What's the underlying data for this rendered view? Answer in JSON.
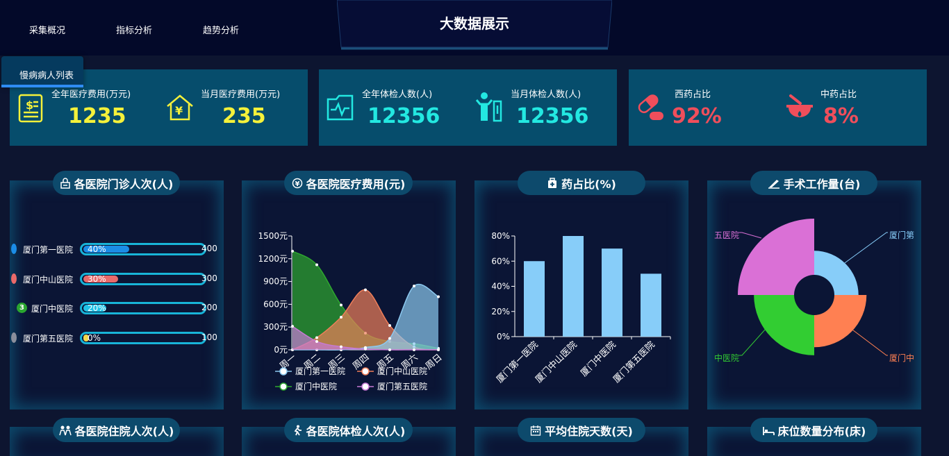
{
  "header": {
    "title": "大数据展示",
    "nav": [
      "采集概况",
      "指标分析",
      "趋势分析"
    ],
    "tab_label": "慢病病人列表"
  },
  "stats": [
    {
      "items": [
        {
          "label": "全年医疗费用(万元)",
          "value": "1235",
          "icon": "bill-icon"
        },
        {
          "label": "当月医疗费用(万元)",
          "value": "235",
          "icon": "house-yen-icon"
        }
      ],
      "color": "#f5f13a"
    },
    {
      "items": [
        {
          "label": "全年体检人数(人)",
          "value": "12356",
          "icon": "medical-folder-icon"
        },
        {
          "label": "当月体检人数(人)",
          "value": "12356",
          "icon": "person-check-icon"
        }
      ],
      "color": "#23e8e1"
    },
    {
      "items": [
        {
          "label": "西药占比",
          "value": "92%",
          "icon": "pill-icon"
        },
        {
          "label": "中药占比",
          "value": "8%",
          "icon": "mortar-icon"
        }
      ],
      "color": "#f04e5b"
    }
  ],
  "panels": {
    "outpatient": {
      "title": "各医院门诊人次(人)",
      "icon": "lock-icon"
    },
    "cost": {
      "title": "各医院医疗费用(元)",
      "icon": "yen-circle-icon"
    },
    "drug": {
      "title": "药占比(%)",
      "icon": "medkit-icon"
    },
    "surgery": {
      "title": "手术工作量(台)",
      "icon": "scalpel-icon"
    },
    "inpatient": {
      "title": "各医院住院人次(人)",
      "icon": "people-icon"
    },
    "checkup": {
      "title": "各医院体检人次(人)",
      "icon": "walk-icon"
    },
    "avgdays": {
      "title": "平均住院天数(天)",
      "icon": "calendar-icon"
    },
    "beds": {
      "title": "床位数量分布(床)",
      "icon": "bed-icon"
    }
  },
  "outpatient_rows": [
    {
      "rank": "1",
      "name": "厦门第一医院",
      "pct": "40%",
      "value": "400",
      "fraction": 0.4,
      "color": "#1b8de6",
      "rankColor": "#1b8de6"
    },
    {
      "rank": "2",
      "name": "厦门中山医院",
      "pct": "30%",
      "value": "300",
      "fraction": 0.3,
      "color": "#e86a6a",
      "rankColor": "#e86a6a"
    },
    {
      "rank": "3",
      "name": "厦门中医院",
      "pct": "20%",
      "value": "200",
      "fraction": 0.2,
      "color": "#21c3e6",
      "rankColor": "#2aa630"
    },
    {
      "rank": "4",
      "name": "厦门第五医院",
      "pct": "0%",
      "value": "100",
      "fraction": 0.05,
      "color": "#f2d64b",
      "rankColor": "#8a8f9c"
    }
  ],
  "chart_data": [
    {
      "type": "area",
      "x": [
        "周一",
        "周二",
        "周三",
        "周四",
        "周五",
        "周六",
        "周日"
      ],
      "ylabels": [
        "0元",
        "300元",
        "600元",
        "900元",
        "1200元",
        "1500元"
      ],
      "ylim": [
        0,
        1500
      ],
      "series": [
        {
          "name": "厦门第一医院",
          "color": "#8cc9f0",
          "values": [
            0,
            0,
            0,
            30,
            150,
            840,
            700
          ]
        },
        {
          "name": "厦门中山医院",
          "color": "#f07f5a",
          "values": [
            0,
            160,
            430,
            790,
            320,
            40,
            0
          ]
        },
        {
          "name": "厦门中医院",
          "color": "#2fa82f",
          "values": [
            1300,
            1120,
            590,
            220,
            110,
            80,
            20
          ]
        },
        {
          "name": "厦门第五医院",
          "color": "#c77ad5",
          "values": [
            310,
            110,
            40,
            10,
            0,
            0,
            0
          ]
        }
      ]
    },
    {
      "type": "bar",
      "categories": [
        "厦门第一医院",
        "厦门中山医院",
        "厦门中医院",
        "厦门第五医院"
      ],
      "values": [
        60,
        80,
        70,
        50
      ],
      "ylabels": [
        "0%",
        "20%",
        "40%",
        "60%",
        "80%"
      ],
      "ylim": [
        0,
        80
      ],
      "color": "#87cdf9"
    },
    {
      "type": "pie",
      "series": [
        {
          "name": "厦门第一医院",
          "label": "厦门第",
          "value": 0.6,
          "color": "#87cdf9"
        },
        {
          "name": "厦门中山医院",
          "label": "厦门中",
          "value": 0.8,
          "color": "#ff8052"
        },
        {
          "name": "厦门中医院",
          "label": "中医院",
          "value": 1.0,
          "color": "#32cd32"
        },
        {
          "name": "厦门第五医院",
          "label": "五医院",
          "value": 1.4,
          "color": "#da70d6"
        }
      ]
    }
  ]
}
